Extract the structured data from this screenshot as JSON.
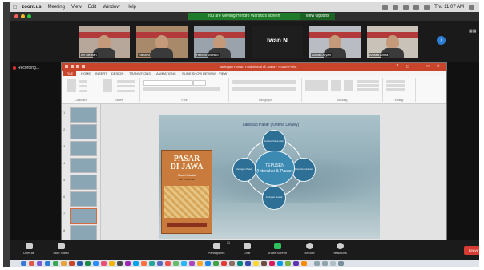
{
  "mac_menu": {
    "app": "zoom.us",
    "items": [
      "Meeting",
      "View",
      "Edit",
      "Window",
      "Help"
    ],
    "clock": "Thu 11:07 AM"
  },
  "zoom": {
    "viewing_banner": "You are viewing Hendro Warsito's screen",
    "view_options": "View Options",
    "participants": [
      {
        "name": "Ari Sleman",
        "color": "#b7a79a"
      },
      {
        "name": "Rahayu",
        "color": "#a88a6a"
      },
      {
        "name": "Hendro Warsito",
        "color": "#9aa3ab"
      },
      {
        "name": "Iwan N",
        "color": "#1e1e1e",
        "video_off": true
      },
      {
        "name": "Adinan Aryan",
        "color": "#b9bcc2"
      },
      {
        "name": "Anissa Amira",
        "color": "#c9c2b9"
      }
    ],
    "next_icon": "chevron-right-icon",
    "recording_label": "Recording...",
    "controls": [
      {
        "label": "Unmute",
        "icon": "mic-off-icon"
      },
      {
        "label": "Stop Video",
        "icon": "video-icon"
      },
      {
        "label": "Participants",
        "icon": "participants-icon",
        "count": "11"
      },
      {
        "label": "Chat",
        "icon": "chat-icon"
      },
      {
        "label": "Share Screen",
        "icon": "share-screen-icon"
      },
      {
        "label": "Record",
        "icon": "record-icon"
      },
      {
        "label": "Reactions",
        "icon": "reactions-icon"
      }
    ],
    "leave_label": "Leave"
  },
  "ppt": {
    "title": "Jaringan Pasar Tradisional di Jawa - PowerPoint",
    "tabs": [
      "FILE",
      "HOME",
      "INSERT",
      "DESIGN",
      "TRANSITIONS",
      "ANIMATIONS",
      "SLIDE SHOW",
      "REVIEW",
      "VIEW"
    ],
    "groups": [
      "Clipboard",
      "Slides",
      "Font",
      "Paragraph",
      "Drawing",
      "Editing"
    ],
    "slide_numbers": [
      "1",
      "2",
      "3",
      "4",
      "5",
      "6",
      "7",
      "8"
    ],
    "slide": {
      "title": "Lanskap Pasar (Kriteria Dewey)",
      "center_line1": "TEPUSEN",
      "center_line2": "(Interaksi & Pasar)",
      "nodes": [
        "Sumber Daya Alam",
        "Pola Pemukiman",
        "Jaringan Sosial",
        "Jaringan Pasar"
      ],
      "book": {
        "title_line1": "PASAR",
        "title_line2": "DI JAWA",
        "subtitle": "Masa Kolonial",
        "author": "Jan Wisseman"
      }
    }
  },
  "colors": {
    "ppt_accent": "#c8452b",
    "zoom_green": "#1f7a2a",
    "leave_red": "#d83b32"
  }
}
